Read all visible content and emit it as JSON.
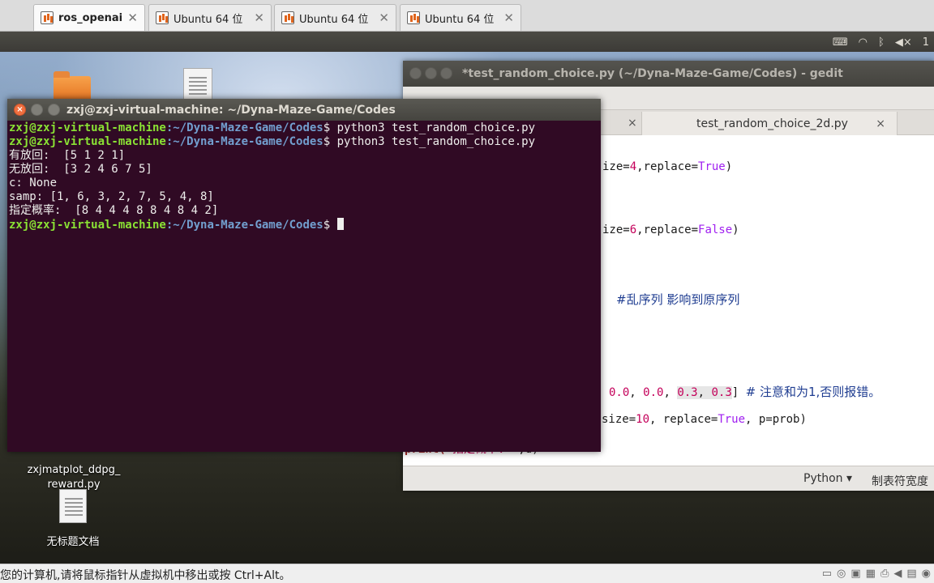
{
  "host_tabs": [
    {
      "label": "ros_openai",
      "active": true
    },
    {
      "label": "Ubuntu 64 位",
      "active": false
    },
    {
      "label": "Ubuntu 64 位",
      "active": false
    },
    {
      "label": "Ubuntu 64 位",
      "active": false
    }
  ],
  "tab_close": "✕",
  "panel": {
    "indicator": "1"
  },
  "desktop_icons": [
    {
      "label": "zxjmatplot_ddpg_\nreward.py"
    },
    {
      "label": "无标题文档"
    }
  ],
  "gedit": {
    "title": "*test_random_choice.py (~/Dyna-Maze-Game/Codes) - gedit",
    "tab": "test_random_choice_2d.py",
    "tab_close": "×",
    "lines": {
      "l1a": "ize=",
      "l1b": "4",
      "l1c": ",replace=",
      "l1d": "True",
      "l1e": ")",
      "l2a": "ize=",
      "l2b": "6",
      "l2c": ",replace=",
      "l2d": "False",
      "l2e": ")",
      "l3": "#乱序列 影响到原序列",
      "l4a": "0.0",
      "l4b": ", ",
      "l4c": "0.0",
      "l4d": ", ",
      "l4e": "0.3",
      "l4f": ", ",
      "l4g": "0.3",
      "l4h": "] ",
      "l4i": "# 注意和为1,否则报错。",
      "l5a": "size=",
      "l5b": "10",
      "l5c": ", replace=",
      "l5d": "True",
      "l5e": ", p=prob)",
      "l6a": "print(",
      "l6b": "'指定概率: '",
      "l6c": ",d)"
    },
    "status_lang": "Python ▾",
    "status_tab": "制表符宽度"
  },
  "terminal": {
    "title": "zxj@zxj-virtual-machine: ~/Dyna-Maze-Game/Codes",
    "prompt_user": "zxj@zxj-virtual-machine",
    "prompt_path": ":~/Dyna-Maze-Game/Codes",
    "prompt_sym": "$ ",
    "cmd1": "python3 test_random_choice.py",
    "cmd2": "python3 test_random_choice.py",
    "out1": "有放回:  [5 1 2 1]",
    "out2": "无放回:  [3 2 4 6 7 5]",
    "out3": "c: None",
    "out4": "samp: [1, 6, 3, 2, 7, 5, 4, 8]",
    "out5": "指定概率:  [8 4 4 4 8 8 4 8 4 2]"
  },
  "host_status": {
    "message": "您的计算机,请将鼠标指针从虚拟机中移出或按 Ctrl+Alt。"
  }
}
